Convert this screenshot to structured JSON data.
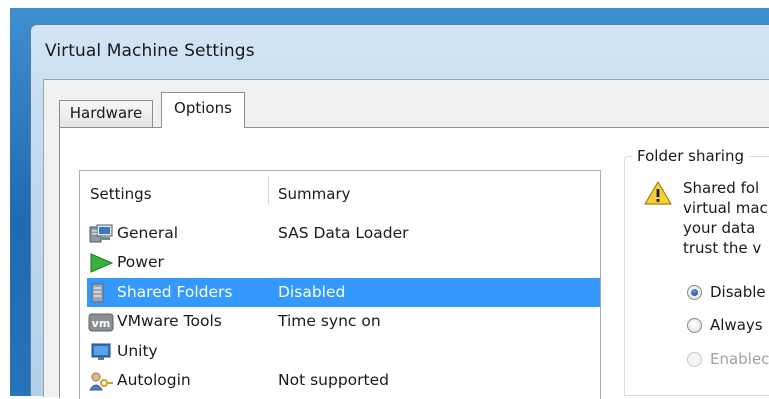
{
  "window": {
    "title": "Virtual Machine Settings"
  },
  "tabs": [
    {
      "label": "Hardware",
      "active": false
    },
    {
      "label": "Options",
      "active": true
    }
  ],
  "settings_list": {
    "columns": [
      "Settings",
      "Summary"
    ],
    "rows": [
      {
        "name": "General",
        "summary": "SAS Data Loader",
        "icon": "computer-icon"
      },
      {
        "name": "Power",
        "summary": "",
        "icon": "play-icon"
      },
      {
        "name": "Shared Folders",
        "summary": "Disabled",
        "icon": "shared-folders-icon",
        "selected": true
      },
      {
        "name": "VMware Tools",
        "summary": "Time sync on",
        "icon": "vmware-icon"
      },
      {
        "name": "Unity",
        "summary": "",
        "icon": "unity-icon"
      },
      {
        "name": "Autologin",
        "summary": "Not supported",
        "icon": "users-key-icon"
      }
    ],
    "selection_color": "#3399ff"
  },
  "folder_sharing": {
    "group_label": "Folder sharing",
    "warning_lines": [
      "Shared fol",
      "virtual mac",
      "your data",
      "trust the v"
    ],
    "options": [
      {
        "label": "Disable",
        "checked": true,
        "enabled": true
      },
      {
        "label": "Always",
        "checked": false,
        "enabled": true
      },
      {
        "label": "Enablec",
        "checked": false,
        "enabled": false
      }
    ]
  }
}
